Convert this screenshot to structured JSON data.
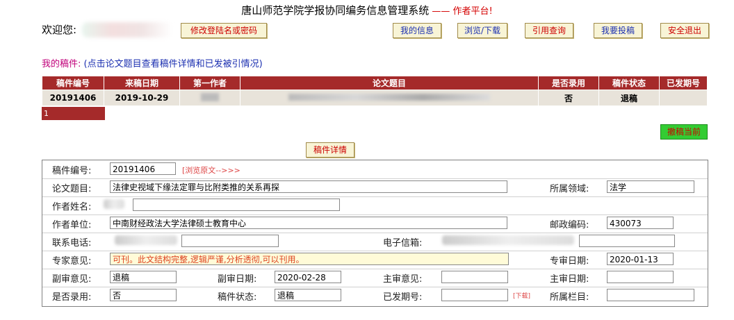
{
  "header": {
    "title": "唐山师范学院学报协同编务信息管理系统",
    "dash": " —— ",
    "platform": "作者平台!"
  },
  "welcome": {
    "label": "欢迎您:",
    "change_btn": "修改登陆名或密码"
  },
  "nav": [
    "我的信息",
    "浏览/下载",
    "引用查询",
    "我要投稿",
    "安全退出"
  ],
  "my_label": "我的稿件:",
  "my_hint": "(点击论文题目查看稿件详情和已发被引情况)",
  "list": {
    "headers": [
      "稿件编号",
      "来稿日期",
      "第一作者",
      "论文题目",
      "是否录用",
      "稿件状态",
      "已发期号"
    ],
    "rows": [
      {
        "id": "20191406",
        "date": "2019-10-29",
        "author": "",
        "title": "",
        "accepted": "否",
        "status": "退稿",
        "issue": ""
      }
    ],
    "pager": "1"
  },
  "withdraw_btn": "撤稿当前",
  "detail_btn": "稿件详情",
  "form": {
    "id_label": "稿件编号:",
    "id_value": "20191406",
    "view_link": "[浏览原文-->>>",
    "title_label": "论文题目:",
    "title_value": "法律史视域下缘法定罪与比附类推的关系再探",
    "field_label": "所属领域:",
    "field_value": "法学",
    "author_label": "作者姓名:",
    "unit_label": "作者单位:",
    "unit_value": "中南财经政法大学法律硕士教育中心",
    "zip_label": "邮政编码:",
    "zip_value": "430073",
    "phone_label": "联系电话:",
    "email_label": "电子信箱:",
    "expert_label": "专家意见:",
    "expert_value": "可刊。此文结构完整,逻辑严谨,分析透彻,可以刊用。",
    "expert_date_label": "专审日期:",
    "expert_date_value": "2020-01-13",
    "vice_label": "副审意见:",
    "vice_value": "退稿",
    "vice_date_label": "副审日期:",
    "vice_date_value": "2020-02-28",
    "chief_label": "主审意见:",
    "chief_date_label": "主审日期:",
    "accept_label": "是否录用:",
    "accept_value": "否",
    "status_label": "稿件状态:",
    "status_value": "退稿",
    "issue_label": "已发期号:",
    "download_link": "[下载]",
    "column_label": "所属栏目:"
  }
}
